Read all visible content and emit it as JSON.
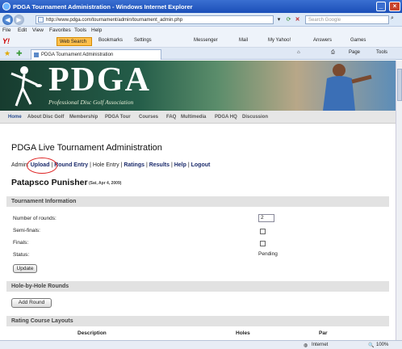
{
  "window": {
    "title": "PDGA Tournament Administration - Windows Internet Explorer"
  },
  "address": {
    "url": "http://www.pdga.com/tournament/admin/tournament_admin.php",
    "search_placeholder": "Search Google"
  },
  "menu": [
    "File",
    "Edit",
    "View",
    "Favorites",
    "Tools",
    "Help"
  ],
  "yahoo_toolbar": {
    "logo": "Y!",
    "web_search": "Web Search",
    "items": [
      "Bookmarks",
      "Settings",
      "Messenger",
      "Mail",
      "My Yahoo!",
      "Answers",
      "Games"
    ]
  },
  "tab": {
    "label": "PDGA Tournament Administration"
  },
  "command_bar": [
    "Page",
    "Tools"
  ],
  "banner": {
    "logo": "PDGA",
    "tagline": "Professional Disc Golf Association"
  },
  "site_nav": [
    "Home",
    "About Disc Golf",
    "Membership",
    "PDGA Tour",
    "Courses",
    "FAQ",
    "Multimedia",
    "PDGA HQ",
    "Discussion"
  ],
  "page": {
    "heading": "PDGA Live Tournament Administration",
    "admin_prefix": "Admin:",
    "admin_links": [
      "Upload",
      "Round Entry",
      "Hole Entry",
      "Ratings",
      "Results",
      "Help",
      "Logout"
    ],
    "event_title": "Patapsco Punisher",
    "event_date": "(Sat, Apr 4, 2009)"
  },
  "tournament_info": {
    "section": "Tournament Information",
    "rounds_label": "Number of rounds:",
    "rounds_value": "2",
    "semifinals_label": "Semi-finals:",
    "finals_label": "Finals:",
    "status_label": "Status:",
    "status_value": "Pending",
    "update_button": "Update"
  },
  "hole_rounds": {
    "section": "Hole-by-Hole Rounds",
    "add_button": "Add Round"
  },
  "rating_layouts": {
    "section": "Rating Course Layouts",
    "columns": [
      "Description",
      "Holes",
      "Par"
    ]
  },
  "status_bar": {
    "zone": "Internet",
    "zoom": "100%"
  }
}
